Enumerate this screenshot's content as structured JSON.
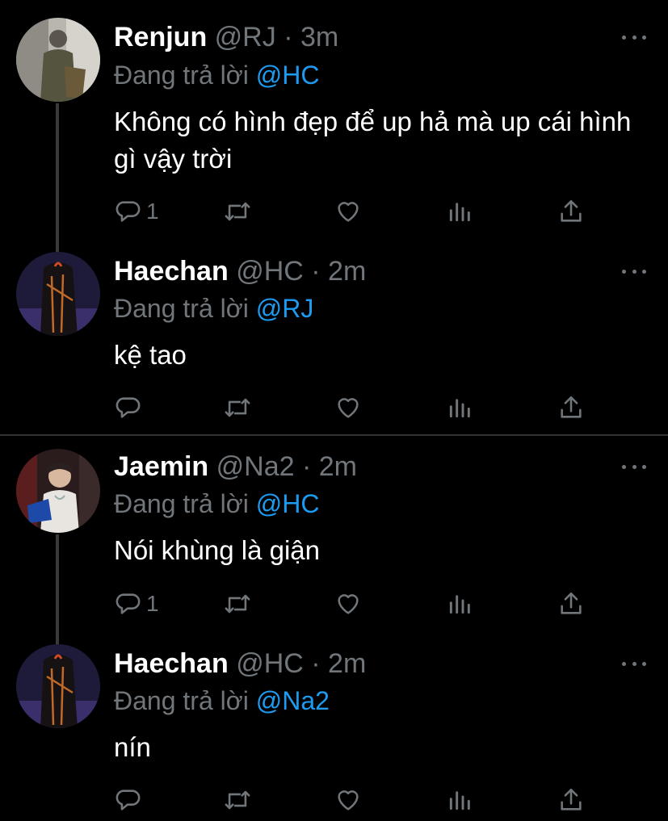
{
  "colors": {
    "background": "#000000",
    "name_text": "#ffffff",
    "muted_text": "#71767b",
    "mention": "#1d9bf0",
    "thread_line": "#3a3a3a"
  },
  "tweets": [
    {
      "name": "Renjun",
      "handle": "@RJ",
      "separator": "·",
      "time": "3m",
      "replying_prefix": "Đang trả lời",
      "replying_to": "@HC",
      "text": "Không có hình đẹp để up hả mà up cái hình gì vậy trời",
      "reply_count": "1"
    },
    {
      "name": "Haechan",
      "handle": "@HC",
      "separator": "·",
      "time": "2m",
      "replying_prefix": "Đang trả lời",
      "replying_to": "@RJ",
      "text": "kệ tao",
      "reply_count": ""
    },
    {
      "name": "Jaemin",
      "handle": "@Na2",
      "separator": "·",
      "time": "2m",
      "replying_prefix": "Đang trả lời",
      "replying_to": "@HC",
      "text": "Nói khùng là giận",
      "reply_count": "1"
    },
    {
      "name": "Haechan",
      "handle": "@HC",
      "separator": "·",
      "time": "2m",
      "replying_prefix": "Đang trả lời",
      "replying_to": "@Na2",
      "text": "nín",
      "reply_count": ""
    }
  ],
  "icons": {
    "reply": "reply-icon",
    "retweet": "retweet-icon",
    "like": "heart-icon",
    "analytics": "analytics-icon",
    "share": "share-icon",
    "more": "more-icon"
  }
}
